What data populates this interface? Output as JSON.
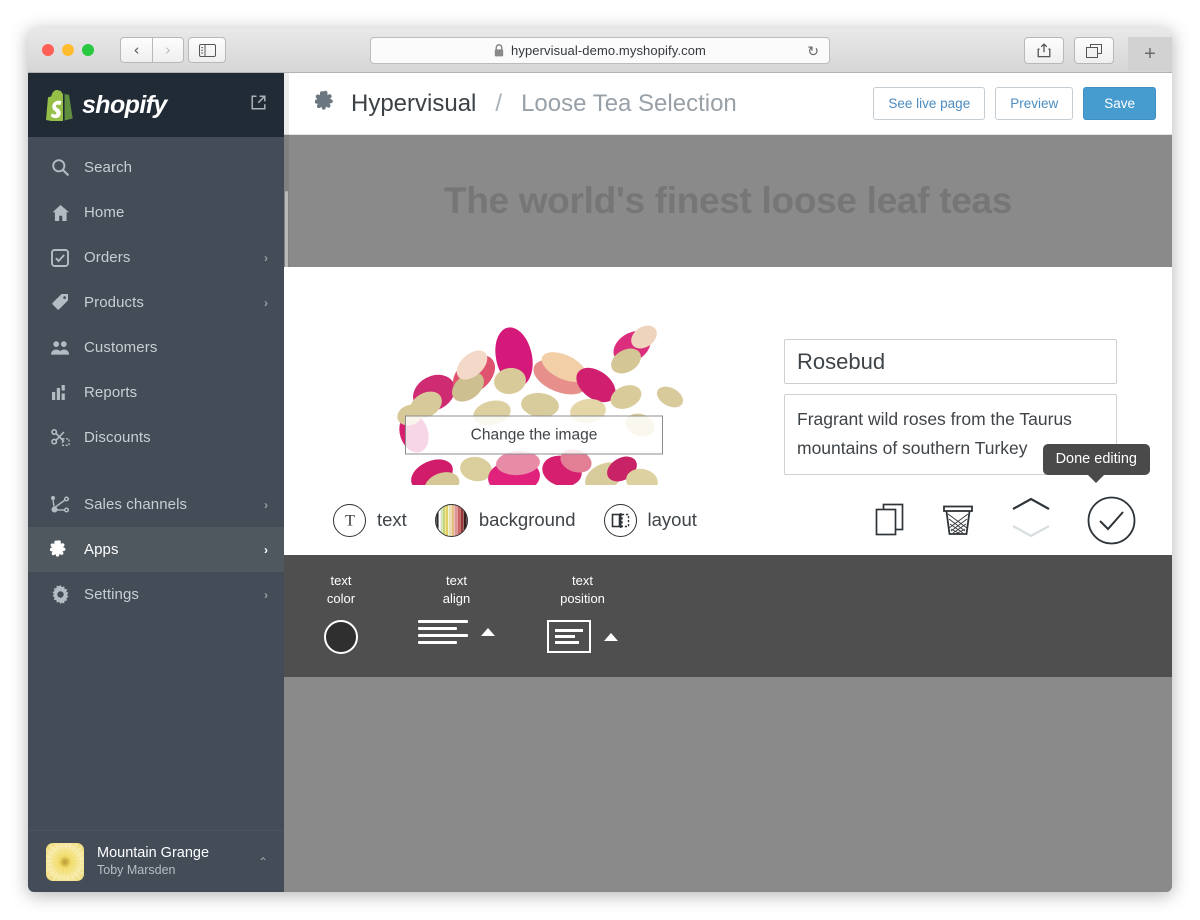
{
  "browser": {
    "url": "hypervisual-demo.myshopify.com",
    "lock_icon": "lock-icon",
    "reload_glyph": "↻",
    "back_glyph": "‹",
    "forward_glyph": "›",
    "new_tab_glyph": "+",
    "traffic_lights": [
      "close-red",
      "minimize-yellow",
      "zoom-green"
    ]
  },
  "sidebar": {
    "brand": "shopify",
    "external_link_icon": "external-link-icon",
    "items": [
      {
        "label": "Search",
        "icon": "search-icon",
        "arrow": "",
        "active": false
      },
      {
        "label": "Home",
        "icon": "home-icon",
        "arrow": "",
        "active": false
      },
      {
        "label": "Orders",
        "icon": "orders-icon",
        "arrow": "›",
        "active": false
      },
      {
        "label": "Products",
        "icon": "products-tag-icon",
        "arrow": "›",
        "active": false
      },
      {
        "label": "Customers",
        "icon": "customers-icon",
        "arrow": "",
        "active": false
      },
      {
        "label": "Reports",
        "icon": "reports-bar-chart-icon",
        "arrow": "",
        "active": false
      },
      {
        "label": "Discounts",
        "icon": "discounts-scissors-icon",
        "arrow": "",
        "active": false
      },
      {
        "label": "Sales channels",
        "icon": "sales-channels-icon",
        "arrow": "›",
        "active": false
      },
      {
        "label": "Apps",
        "icon": "apps-puzzle-icon",
        "arrow": "›",
        "active": true
      },
      {
        "label": "Settings",
        "icon": "settings-gear-icon",
        "arrow": "›",
        "active": false
      }
    ],
    "store": {
      "name": "Mountain Grange",
      "user": "Toby Marsden",
      "caret": "⌃",
      "avatar_icon": "store-avatar"
    }
  },
  "header": {
    "app_icon": "puzzle-icon",
    "app_name": "Hypervisual",
    "separator": "/",
    "page_name": "Loose Tea Selection",
    "buttons": [
      {
        "label": "See live page",
        "style": "secondary"
      },
      {
        "label": "Preview",
        "style": "secondary"
      },
      {
        "label": "Save",
        "style": "primary"
      }
    ]
  },
  "hero": {
    "title": "The world's finest loose leaf teas",
    "bg_color": "#8a8a8a",
    "text_color": "#767676"
  },
  "canvas": {
    "image_overlay_button": "Change the image",
    "image_alt": "dried pink rosebuds scattered on white",
    "title_field": {
      "value": "Rosebud"
    },
    "description_field": {
      "value": "Fragrant wild roses from the Taurus mountains of southern Turkey"
    }
  },
  "toolbar": {
    "tabs": [
      {
        "label": "text",
        "icon": "text-T-icon",
        "active": true
      },
      {
        "label": "background",
        "icon": "background-color-wheel-icon",
        "active": false
      },
      {
        "label": "layout",
        "icon": "layout-columns-icon",
        "active": false
      }
    ],
    "actions": [
      {
        "name": "duplicate",
        "icon": "duplicate-icon"
      },
      {
        "name": "delete",
        "icon": "trash-icon"
      },
      {
        "name": "move-up",
        "icon": "chevron-up-icon"
      },
      {
        "name": "move-down",
        "icon": "chevron-down-icon"
      },
      {
        "name": "done-editing",
        "icon": "check-circle-icon"
      }
    ],
    "tooltip": "Done editing"
  },
  "panel": {
    "controls": [
      {
        "label_line1": "text",
        "label_line2": "color",
        "type": "color-swatch",
        "value": "#2f2f2f"
      },
      {
        "label_line1": "text",
        "label_line2": "align",
        "type": "align-left",
        "caret": "▲"
      },
      {
        "label_line1": "text",
        "label_line2": "position",
        "type": "position-left",
        "caret": "▲"
      }
    ]
  },
  "colors": {
    "accent": "#479ccf",
    "sidebar_bg": "#434c57",
    "sidebar_brand_bg": "#212b36",
    "sidebar_active": "#50585f",
    "panel_bg": "#4f4f4f",
    "canvas_bg": "#8a8a8a",
    "link": "#4b8dc2"
  }
}
